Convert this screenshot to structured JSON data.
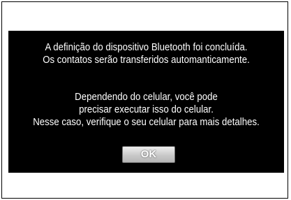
{
  "dialog": {
    "message_line_1": "A definição do dispositivo Bluetooth foi concluída.",
    "message_line_2": "Os contatos serão transferidos automanticamente.",
    "message_line_3": "Dependendo do celular, você pode",
    "message_line_4": "precisar executar isso do celular.",
    "message_line_5": "Nesse caso, verifique o seu celular para mais detalhes.",
    "ok_label": "OK"
  },
  "colors": {
    "screen_background": "#000000",
    "text": "#ffffff",
    "button_face": "#c9c9c9"
  }
}
